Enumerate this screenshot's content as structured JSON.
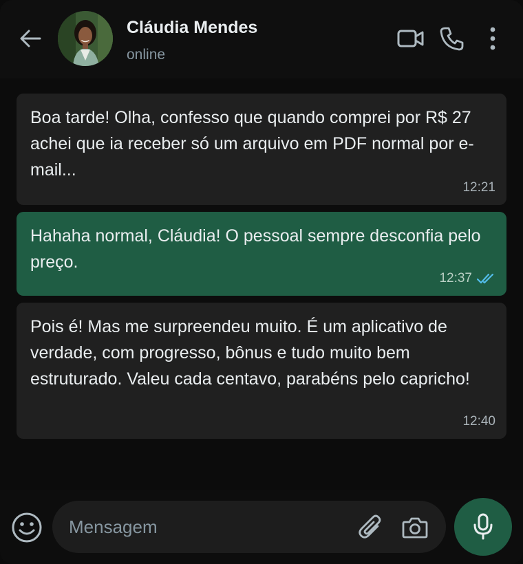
{
  "theme": {
    "header_bg": "#0f0f0f",
    "incoming_bubble": "#202020",
    "outgoing_bubble": "#1f5d44",
    "read_tick_color": "#53bdeb",
    "icon_color": "#aebac1"
  },
  "header": {
    "back_icon": "arrow-left-icon",
    "contact_name": "Cláudia Mendes",
    "status": "online",
    "actions": [
      "video-call-icon",
      "phone-icon",
      "more-vertical-icon"
    ]
  },
  "messages": [
    {
      "direction": "incoming",
      "text": "Boa tarde! Olha, confesso que quando comprei por R$ 27 achei que ia receber só um arquivo em PDF normal por e-mail...",
      "time": "12:21"
    },
    {
      "direction": "outgoing",
      "text": "Hahaha normal, Cláudia! O pessoal sempre desconfia pelo preço.",
      "time": "12:37",
      "status_icon": "double-check-read-icon"
    },
    {
      "direction": "incoming",
      "text": "Pois é! Mas me surpreendeu muito. É um aplicativo de verdade, com progresso, bônus e tudo muito bem estruturado. Valeu cada centavo, parabéns pelo capricho!",
      "time": "12:40"
    }
  ],
  "composer": {
    "emoji_icon": "emoji-icon",
    "placeholder": "Mensagem",
    "attach_icon": "paperclip-icon",
    "camera_icon": "camera-icon",
    "mic_icon": "microphone-icon"
  }
}
